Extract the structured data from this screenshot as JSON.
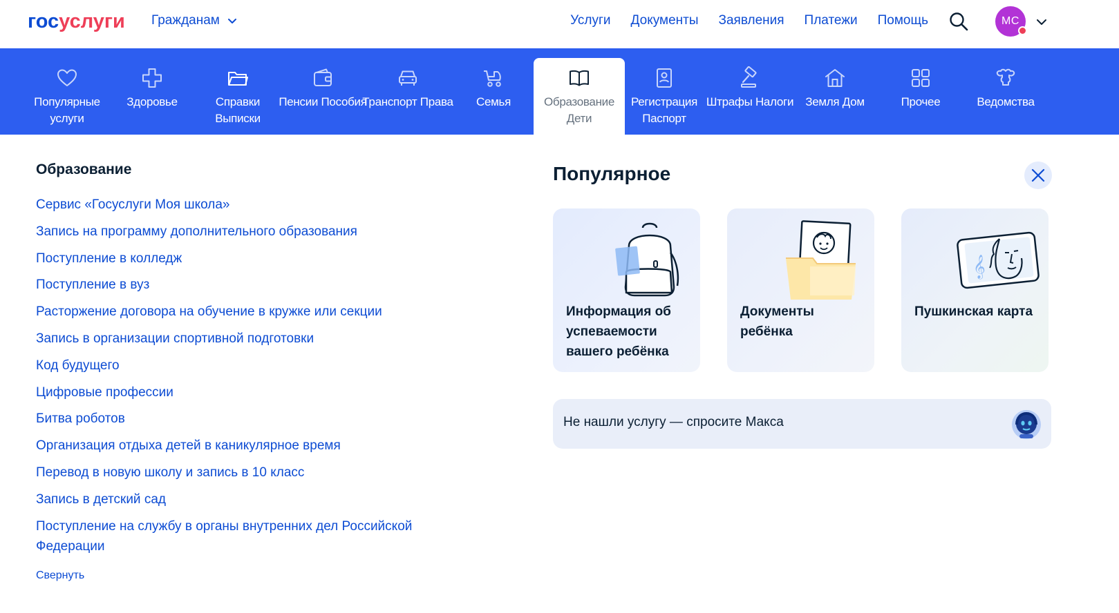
{
  "header": {
    "logo_part1": "гос",
    "logo_part2": "услуги",
    "audience": "Гражданам",
    "nav": [
      "Услуги",
      "Документы",
      "Заявления",
      "Платежи",
      "Помощь"
    ],
    "user_initials": "МС",
    "colors": {
      "primary": "#0d4cd3",
      "accent": "#ee3f58",
      "avatar": "#b233d6"
    }
  },
  "categories": [
    {
      "label": "Популярные услуги",
      "icon": "heart-icon"
    },
    {
      "label": "Здоровье",
      "icon": "medical-cross-icon"
    },
    {
      "label": "Справки Выписки",
      "icon": "folder-icon"
    },
    {
      "label": "Пенсии Пособия",
      "icon": "wallet-icon"
    },
    {
      "label": "Транспорт Права",
      "icon": "car-icon"
    },
    {
      "label": "Семья",
      "icon": "stroller-icon"
    },
    {
      "label": "Образование Дети",
      "icon": "book-icon",
      "active": true
    },
    {
      "label": "Регистрация Паспорт",
      "icon": "id-card-icon"
    },
    {
      "label": "Штрафы Налоги",
      "icon": "gavel-icon"
    },
    {
      "label": "Земля Дом",
      "icon": "house-icon"
    },
    {
      "label": "Прочее",
      "icon": "grid-icon"
    },
    {
      "label": "Ведомства",
      "icon": "emblem-icon"
    }
  ],
  "education": {
    "title": "Образование",
    "links": [
      "Сервис «Госуслуги Моя школа»",
      "Запись на программу дополнительного образования",
      "Поступление в колледж",
      "Поступление в вуз",
      "Расторжение договора на обучение в кружке или секции",
      "Запись в организации спортивной подготовки",
      "Код будущего",
      "Цифровые профессии",
      "Битва роботов",
      "Организация отдыха детей в каникулярное время",
      "Перевод в новую школу и запись в 10 класс",
      "Запись в детский сад",
      "Поступление на службу в органы внутренних дел Российской Федерации"
    ],
    "collapse": "Свернуть"
  },
  "popular": {
    "title": "Популярное",
    "cards": [
      {
        "text": "Информация об успеваемости вашего ребёнка",
        "icon": "backpack-icon"
      },
      {
        "text": "Документы ребёнка",
        "icon": "child-documents-icon"
      },
      {
        "text": "Пушкинская карта",
        "icon": "pushkin-card-icon"
      }
    ],
    "ask": "Не нашли услугу — спросите Макса"
  }
}
